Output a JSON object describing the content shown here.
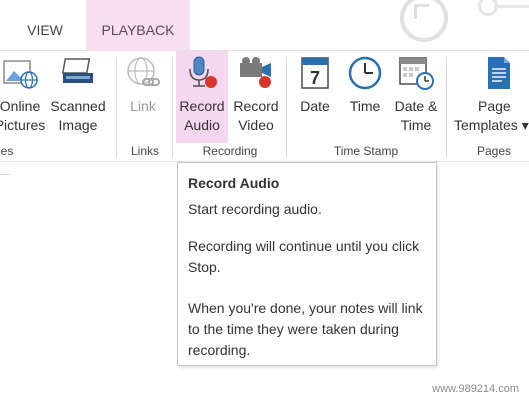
{
  "tabs": {
    "view": "VIEW",
    "playback": "PLAYBACK"
  },
  "ribbon": {
    "buttons": {
      "online_pictures": [
        "Online",
        "Pictures"
      ],
      "scanned_image": [
        "Scanned",
        "Image"
      ],
      "link": [
        "Link"
      ],
      "record_audio": [
        "Record",
        "Audio"
      ],
      "record_video": [
        "Record",
        "Video"
      ],
      "date": [
        "Date"
      ],
      "time": [
        "Time"
      ],
      "date_time": [
        "Date &",
        "Time"
      ],
      "page_templates": [
        "Page",
        "Templates ▾"
      ]
    },
    "date_icon_number": "7",
    "groups": {
      "images_fragment": "es",
      "links": "Links",
      "recording": "Recording",
      "time_stamp": "Time Stamp",
      "pages": "Pages"
    }
  },
  "tooltip": {
    "title": "Record Audio",
    "line1": "Start recording audio.",
    "line2": "Recording will continue until you click Stop.",
    "line3": "When you're done, your notes will link to the time they were taken during recording."
  },
  "watermark": "www.989214.com",
  "colors": {
    "tab_active_bg": "#f7dff0",
    "pressed_bg": "#f5d8ef",
    "record_red": "#d9362b",
    "icon_blue": "#2b6fb3"
  }
}
